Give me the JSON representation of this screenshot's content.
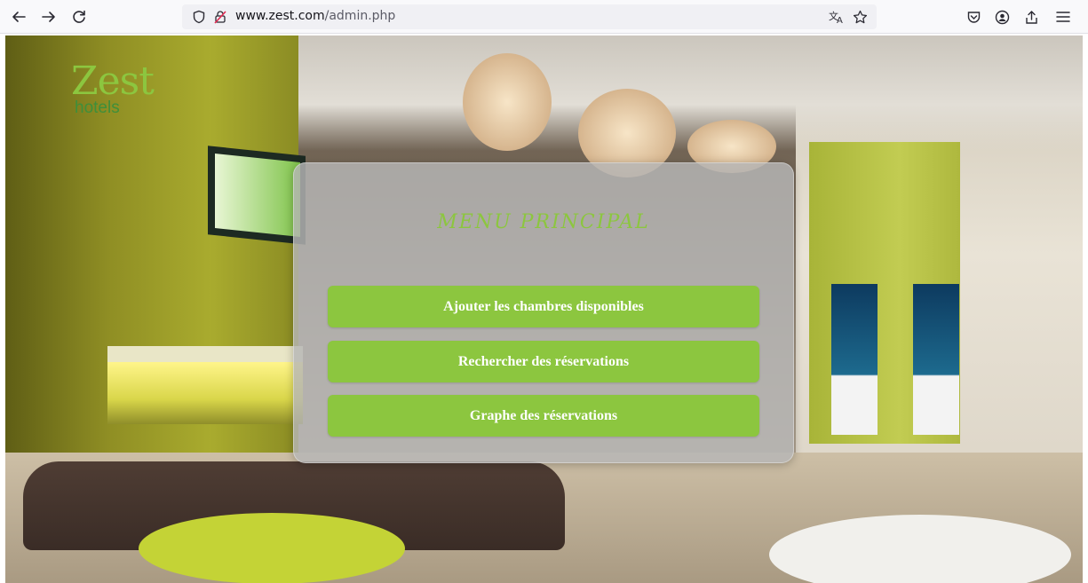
{
  "browser": {
    "url_host": "www.zest.com",
    "url_path": "/admin.php",
    "icons": {
      "back": "back-arrow-icon",
      "forward": "forward-arrow-icon",
      "reload": "reload-icon",
      "shield": "shield-icon",
      "lock": "insecure-lock-icon",
      "translate": "translate-icon",
      "bookmark": "star-icon",
      "pocket": "pocket-icon",
      "account": "account-icon",
      "share": "share-icon",
      "menu": "hamburger-menu-icon"
    }
  },
  "logo": {
    "word": "Zest",
    "sub": "hotels"
  },
  "menu": {
    "title": "MENU PRINCIPAL",
    "buttons": [
      {
        "label": "Ajouter les chambres disponibles"
      },
      {
        "label": "Rechercher des réservations"
      },
      {
        "label": "Graphe des réservations"
      }
    ]
  },
  "colors": {
    "accent_green": "#8cc63f",
    "panel": "#b6b6b6"
  }
}
